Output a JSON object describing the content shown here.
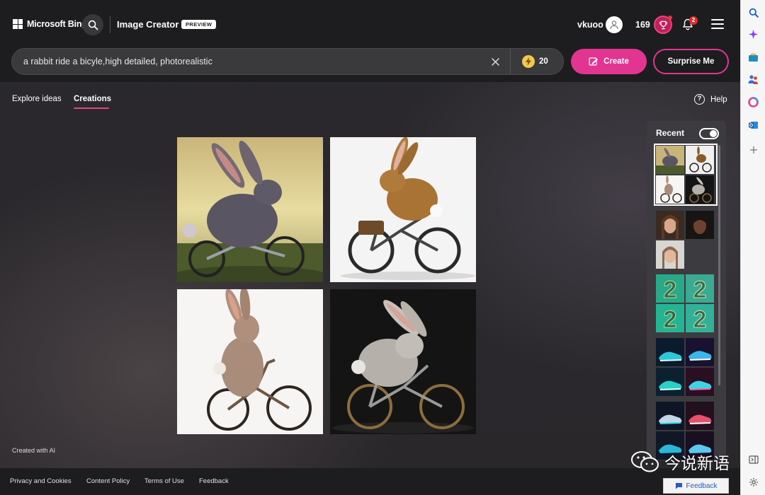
{
  "header": {
    "brand": "Microsoft Bing",
    "app_title": "Image Creator",
    "preview_badge": "PREVIEW",
    "username": "vkuoo",
    "rewards_count": "169",
    "notification_count": "2"
  },
  "prompt": {
    "value": "a rabbit ride a bicyle,high detailed, photorealistic",
    "boosts": "20",
    "create_label": "Create",
    "surprise_label": "Surprise Me"
  },
  "tabs": {
    "explore": "Explore ideas",
    "creations": "Creations",
    "active": "Creations",
    "help": "Help"
  },
  "images": [
    {
      "alt": "rabbit riding bicycle 1"
    },
    {
      "alt": "rabbit riding bicycle 2"
    },
    {
      "alt": "rabbit riding bicycle 3"
    },
    {
      "alt": "rabbit riding bicycle 4"
    }
  ],
  "recent": {
    "title": "Recent",
    "toggle_on": true,
    "groups": [
      "rabbits-bicycle",
      "portraits",
      "number-2",
      "sneakers-1",
      "sneakers-2"
    ]
  },
  "created_with_ai": "Created with AI",
  "footer": {
    "privacy": "Privacy and Cookies",
    "content_policy": "Content Policy",
    "terms": "Terms of Use",
    "feedback": "Feedback",
    "feedback_button": "Feedback"
  },
  "watermark": "今说新语",
  "colors": {
    "accent": "#e23592",
    "header_bg": "#1d1d1f",
    "badge_red": "#e02e2e"
  }
}
